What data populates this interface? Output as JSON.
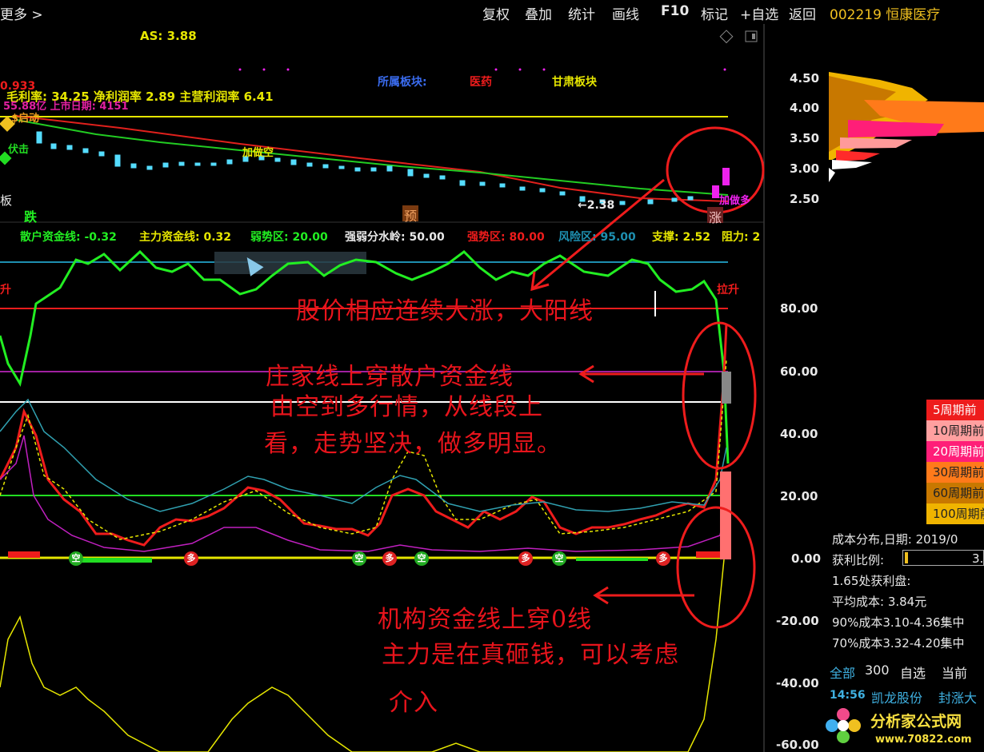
{
  "toolbar": {
    "back_more": "更多 >",
    "items": [
      "复权",
      "叠加",
      "统计",
      "画线",
      "F10",
      "标记",
      "+自选",
      "返回"
    ],
    "stock": "002219 恒康医疗"
  },
  "top_chart": {
    "as_label": "AS: 3.88",
    "finance_line": "毛利率: 34.25 净利润率 2.89 主营利润率 6.41",
    "cap_line": "55.88亿 上市日期: 4151",
    "price_top": "0.933",
    "sector_label": "所属板块:",
    "sector_1": "医药",
    "sector_2": "甘肃板块",
    "low_price": "←2.38",
    "signal_die": "跌",
    "signal_yu": "预",
    "signal_zhang": "涨",
    "signal_fu": "伏击",
    "signal_ban": "板",
    "label_jiacang": "加做空",
    "label_jiazuoduo": "加做多",
    "label_qidong": "$启动"
  },
  "indicator_line": {
    "retail": "散户资金线: -0.32",
    "main": "主力资金线: 0.32",
    "weak": "弱势区: 20.00",
    "water": "强弱分水岭: 50.00",
    "strong": "强势区: 80.00",
    "risk": "风险区: 95.00",
    "support": "支撑: 2.52",
    "resist": "阻力: 2"
  },
  "sub_chart": {
    "rise_left": "升",
    "rise_right": "拉升",
    "markers": [
      "空",
      "多",
      "空",
      "多",
      "空",
      "多",
      "空",
      "多"
    ]
  },
  "axis": {
    "price_ticks": [
      "4.50",
      "4.00",
      "3.50",
      "3.00",
      "2.50"
    ],
    "ind_ticks": [
      "80.00",
      "60.00",
      "40.00",
      "20.00",
      "0.00",
      "-20.00",
      "-40.00",
      "-60.00"
    ]
  },
  "annotations": {
    "a1": "股价相应连续大涨，大阳线",
    "a2": "庄家线上穿散户资金线",
    "a3": "由空到多行情，从线段上",
    "a4": "看，走势坚决，做多明显。",
    "a5": "机构资金线上穿0线",
    "a6": "主力是在真砸钱，可以考虑",
    "a7": "介入"
  },
  "cost_legend": [
    "5周期前",
    "10周期前",
    "20周期前",
    "30周期前",
    "60周期前",
    "100周期前"
  ],
  "cost_info": {
    "date": "成本分布,日期: 2019/0",
    "profit_label": "获利比例:",
    "profit_val": "3.",
    "profit_at": "1.65处获利盘:",
    "avg": "平均成本: 3.84元",
    "c90": "90%成本3.10-4.36集中",
    "c70": "70%成本3.32-4.20集中"
  },
  "bottom_bar": {
    "all": "全部",
    "count": "300",
    "watch": "自选",
    "current": "当前",
    "time": "14:56",
    "name": "凯龙股份",
    "status": "封涨大"
  },
  "watermark": {
    "name": "分析家公式网",
    "url": "www.70822.com"
  },
  "colors": {
    "annotation": "#e8141c",
    "price_axis": "#e8e8e8",
    "stock": "#f0c020"
  }
}
